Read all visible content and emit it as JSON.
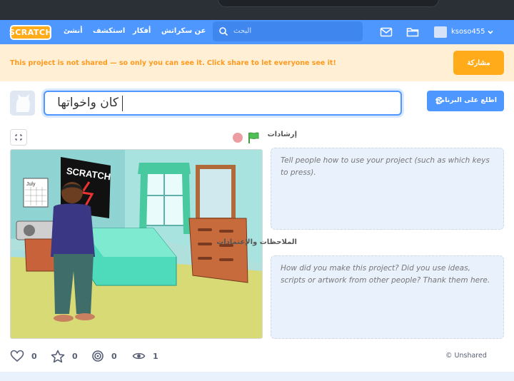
{
  "nav": {
    "logo_text": "SCRATCH",
    "create": "أنشئ",
    "explore": "استكشف",
    "ideas": "أفكار",
    "about": "عن سكراتش",
    "search_placeholder": "البحث",
    "username": "ksoso455",
    "icons": {
      "search": "search-icon",
      "messages": "envelope-icon",
      "mystuff": "folder-icon",
      "caret": "chevron-down-icon"
    }
  },
  "banner": {
    "message": "This project is not shared — so only you can see it. Click share to let everyone see it!",
    "share_label": "مشاركة"
  },
  "project": {
    "title": "كان واخواتها",
    "see_inside_label": "اطلع على البرنامج"
  },
  "instructions": {
    "label": "إرشادات",
    "placeholder": "Tell people how to use your project (such as which keys to press)."
  },
  "notes": {
    "label": "الملاحظات والإعتمادات",
    "placeholder": "How did you make this project? Did you use ideas, scripts or artwork from other people? Thank them here."
  },
  "stats": {
    "loves": "0",
    "favorites": "0",
    "remixes": "0",
    "views": "1"
  },
  "unshared_label": "© Unshared",
  "stage_art": {
    "poster_text": "SCRATCH",
    "calendar_text": "July"
  },
  "colors": {
    "nav": "#4d97ff",
    "share": "#ffab1a",
    "banner_bg": "#ffefd5",
    "flag": "#4cbf56",
    "stop": "#ec9da2"
  }
}
